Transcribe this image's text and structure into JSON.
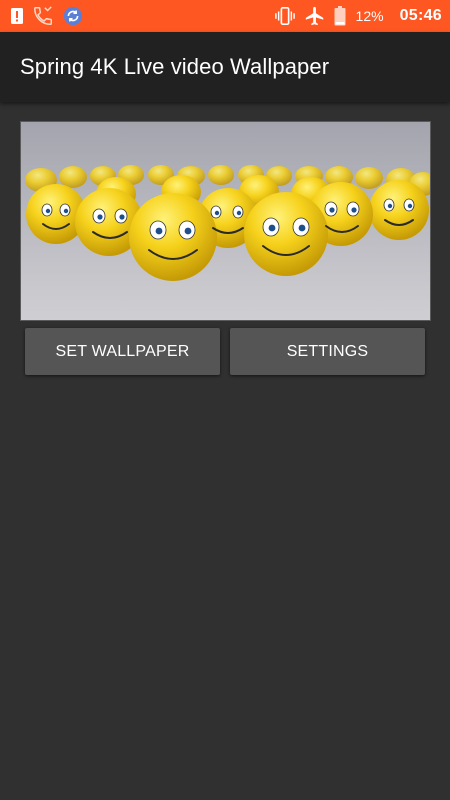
{
  "status_bar": {
    "left_icons": [
      "alert-icon",
      "missed-call-icon",
      "sync-icon"
    ],
    "right_icons": [
      "vibrate-icon",
      "airplane-icon",
      "battery-icon"
    ],
    "battery_percent": "12%",
    "time": "05:46",
    "background_color": "#ff5722"
  },
  "app_bar": {
    "title": "Spring 4K Live video Wallpaper",
    "background_color": "#212121"
  },
  "preview": {
    "description_icon": "smiley-balls-image"
  },
  "buttons": {
    "set_wallpaper": "SET WALLPAPER",
    "settings": "SETTINGS"
  },
  "colors": {
    "background": "#303030",
    "button": "#555555",
    "text": "#ffffff"
  }
}
